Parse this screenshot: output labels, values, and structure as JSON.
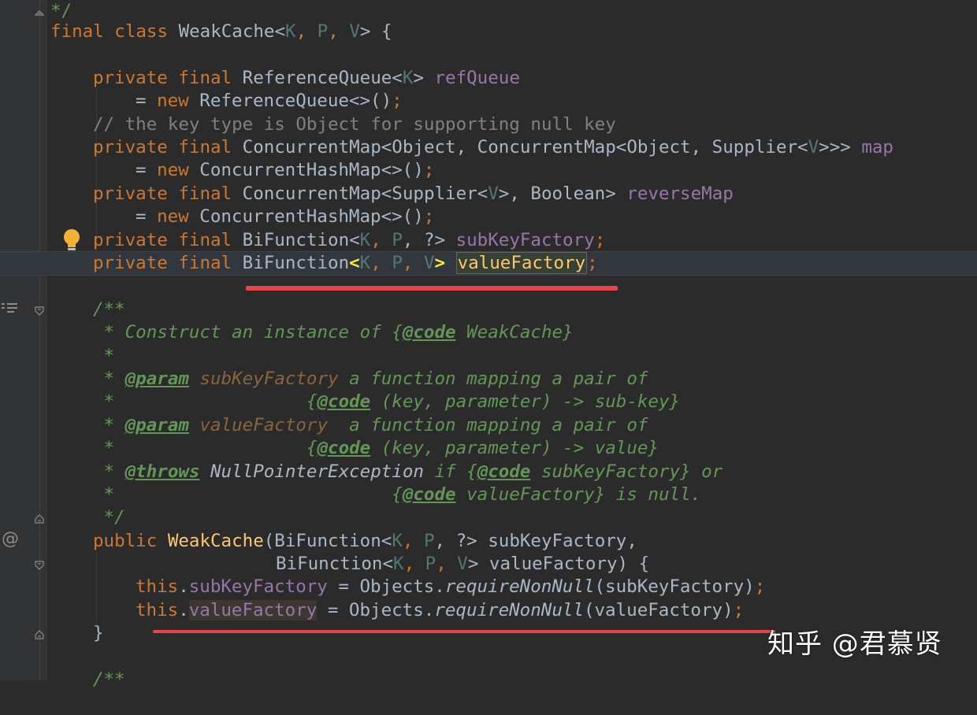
{
  "editor": {
    "lines": {
      "l1": {
        "tail": "*/"
      },
      "l2": {
        "kw": "final class ",
        "cls": "WeakCache",
        "lt": "<",
        "K": "K",
        "c1": ", ",
        "P": "P",
        "c2": ", ",
        "V": "V",
        "gt": "> {"
      },
      "l3": {
        "kw": "private final ",
        "t": "ReferenceQueue<",
        "K": "K",
        "gt": "> ",
        "f": "refQueue"
      },
      "l4": {
        "eq": "= ",
        "kw": "new ",
        "t": "ReferenceQueue<>()",
        "semi": ";"
      },
      "l5": {
        "comment": "// the key type is Object for supporting null key"
      },
      "l6": {
        "kw": "private final ",
        "t": "ConcurrentMap<Object, ConcurrentMap<Object, Supplier<",
        "V": "V",
        "gt": ">>> ",
        "f": "map"
      },
      "l7": {
        "eq": "= ",
        "kw": "new ",
        "t": "ConcurrentHashMap<>()",
        "semi": ";"
      },
      "l8": {
        "kw": "private final ",
        "t": "ConcurrentMap<Supplier<",
        "V": "V",
        "t2": ">, Boolean> ",
        "f": "reverseMap"
      },
      "l9": {
        "eq": "= ",
        "kw": "new ",
        "t": "ConcurrentHashMap<>()",
        "semi": ";"
      },
      "l10": {
        "kw": "private final ",
        "t": "BiFunction<",
        "K": "K",
        "c1": ", ",
        "P": "P",
        "t2": ", ?> ",
        "f": "subKeyFactory",
        "semi": ";"
      },
      "l11": {
        "kw": "private final ",
        "t": "BiFunction",
        "lt": "<",
        "K": "K",
        "c1": ", ",
        "P": "P",
        "c2": ", ",
        "V": "V",
        "gt": ">",
        "sp": " ",
        "f": "valueFactory",
        "semi": ";"
      },
      "l12": {
        "doc": "/**"
      },
      "l13": {
        "star": " * Construct an instance of {",
        "tag": "@code",
        "rest": " WeakCache}"
      },
      "l14": {
        "star": " *"
      },
      "l15": {
        "star": " * ",
        "tag": "@param",
        "ref": " subKeyFactory",
        "rest": " a function mapping a pair of"
      },
      "l16": {
        "star": " *                  {",
        "tag": "@code",
        "rest": " (key, parameter) -> sub-key}"
      },
      "l17": {
        "star": " * ",
        "tag": "@param",
        "ref": " valueFactory",
        "rest": "  a function mapping a pair of"
      },
      "l18": {
        "star": " *                  {",
        "tag": "@code",
        "rest": " (key, parameter) -> value}"
      },
      "l19": {
        "star": " * ",
        "tag": "@throws",
        "ex": " NullPointerException",
        "rest": " if {",
        "tag2": "@code",
        "rest2": " subKeyFactory} or"
      },
      "l20": {
        "star": " *                          {",
        "tag": "@code",
        "rest": " valueFactory} is null."
      },
      "l21": {
        "star": " */"
      },
      "l22": {
        "kw": "public ",
        "fn": "WeakCache",
        "t": "(BiFunction<",
        "K": "K",
        "c1": ", ",
        "P": "P",
        "t2": ", ?> subKeyFactory,"
      },
      "l23": {
        "t": "BiFunction<",
        "K": "K",
        "c1": ", ",
        "P": "P",
        "c2": ", ",
        "V": "V",
        "t2": "> valueFactory) {"
      },
      "l24": {
        "kw": "this",
        "dot": ".",
        "f": "subKeyFactory",
        "t": " = Objects.",
        "m": "requireNonNull",
        "t2": "(subKeyFactory)",
        "semi": ";"
      },
      "l25": {
        "kw": "this",
        "dot": ".",
        "f": "valueFactory",
        "t": " = Objects.",
        "m": "requireNonNull",
        "t2": "(valueFactory)",
        "semi": ";"
      },
      "l26": {
        "t": "}"
      },
      "l27": {
        "doc": "/**"
      }
    }
  },
  "gutter": {
    "at_symbol": "@"
  },
  "watermark": {
    "text": "知乎 @君慕贤"
  },
  "colors": {
    "background": "#2b2b2b",
    "keyword": "#cc7832",
    "field": "#9876aa",
    "method": "#ffc66d",
    "doc": "#629755",
    "annotation_underline": "#e8434a"
  }
}
